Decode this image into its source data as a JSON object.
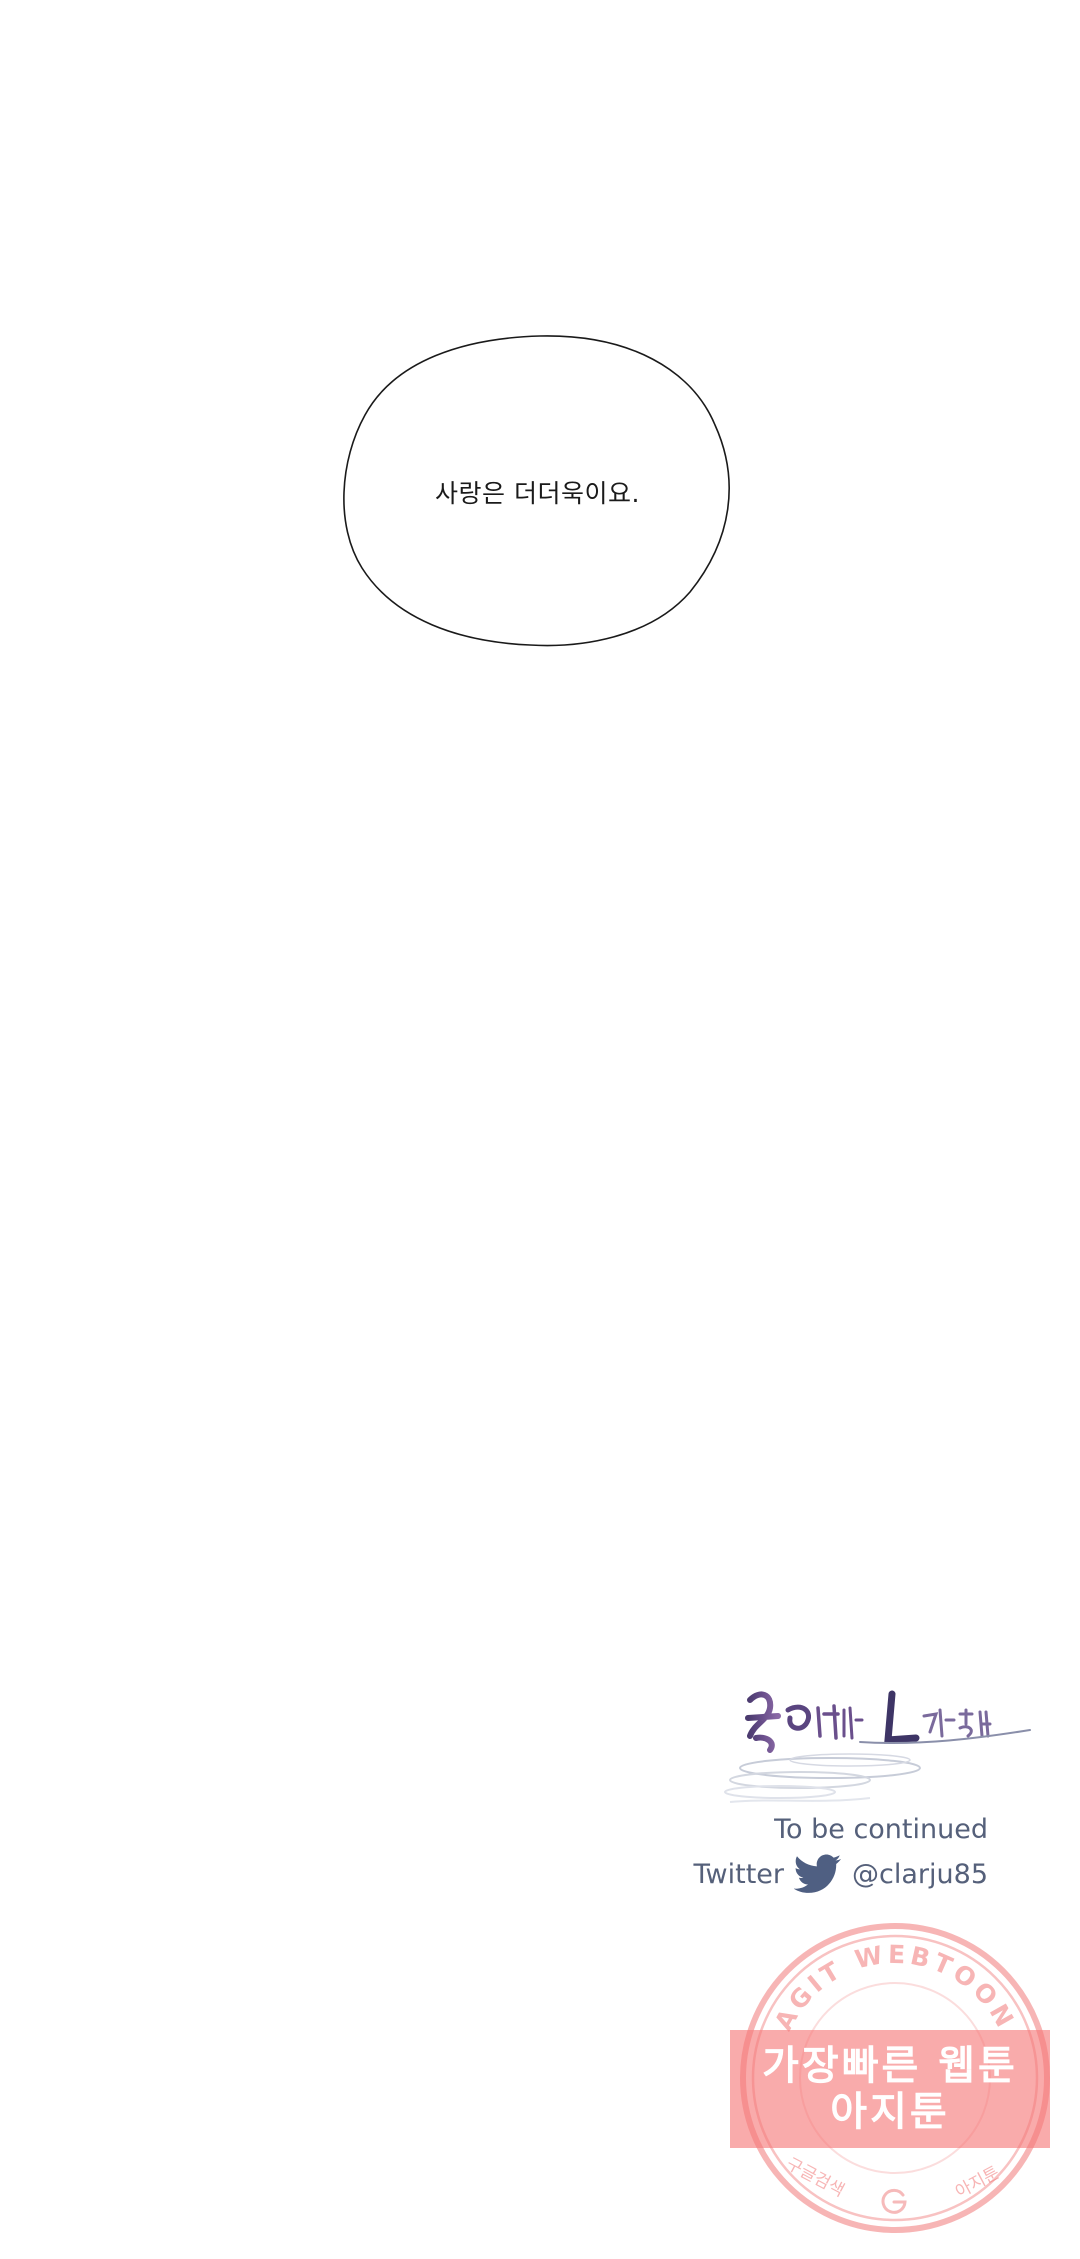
{
  "bubble": {
    "text": "사랑은 더더욱이요."
  },
  "credits": {
    "logo_text": "물밑에서 느껴지는",
    "to_be_continued": "To be continued",
    "twitter_label": "Twitter",
    "twitter_handle": "@clarju85",
    "twitter_icon": "twitter-bird-icon",
    "text_color": "#55607a"
  },
  "watermark": {
    "arc_text": "AGIT WEBTOON",
    "line1": "가장빠른 웹툰",
    "line2": "아지툰",
    "bottom_left": "구글검색",
    "bottom_right": "아지툰",
    "color": "#f07878"
  }
}
